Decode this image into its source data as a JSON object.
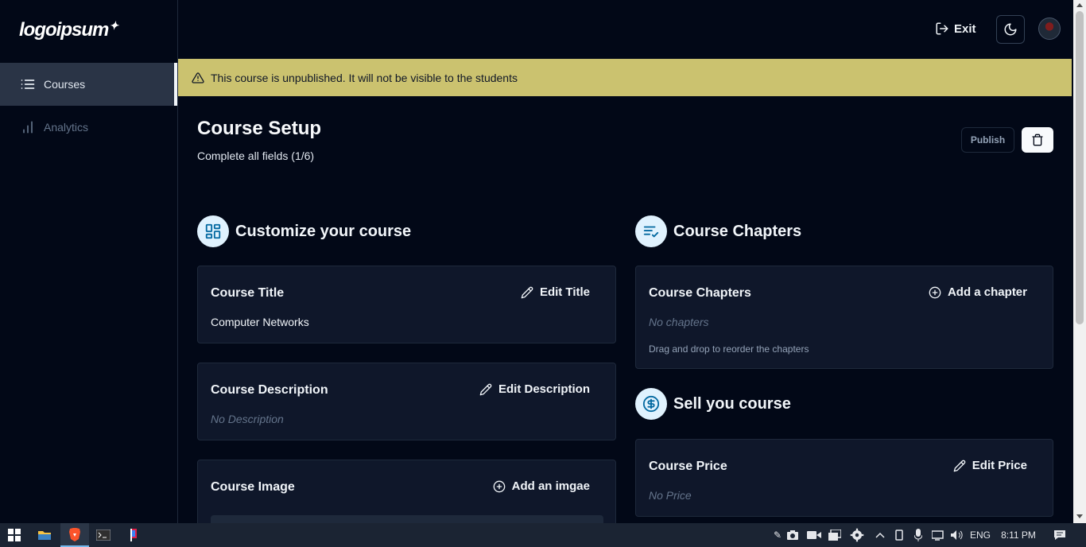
{
  "sidebar": {
    "logo": "logoipsum",
    "items": [
      {
        "label": "Courses",
        "icon": "list-icon",
        "active": true
      },
      {
        "label": "Analytics",
        "icon": "bar-chart-icon",
        "active": false
      }
    ]
  },
  "topbar": {
    "exit_label": "Exit"
  },
  "banner": {
    "text": "This course is unpublished. It will not be visible to the students"
  },
  "setup": {
    "title": "Course Setup",
    "subtitle": "Complete all fields (1/6)",
    "publish_label": "Publish"
  },
  "customize": {
    "heading": "Customize your course",
    "title_card": {
      "title": "Course Title",
      "action": "Edit Title",
      "value": "Computer Networks"
    },
    "description_card": {
      "title": "Course Description",
      "action": "Edit Description",
      "value": "No Description"
    },
    "image_card": {
      "title": "Course Image",
      "action": "Add an imgae"
    }
  },
  "chapters": {
    "heading": "Course Chapters",
    "card": {
      "title": "Course Chapters",
      "action": "Add a chapter",
      "value": "No chapters",
      "hint": "Drag and drop to reorder the chapters"
    }
  },
  "sell": {
    "heading": "Sell you course",
    "price_card": {
      "title": "Course Price",
      "action": "Edit Price",
      "value": "No Price"
    }
  },
  "taskbar": {
    "language": "ENG",
    "time": "8:11 PM"
  },
  "colors": {
    "background": "#020817",
    "banner": "#cbc26f",
    "card": "#0f172a",
    "icon_accent": "#0369a1"
  }
}
